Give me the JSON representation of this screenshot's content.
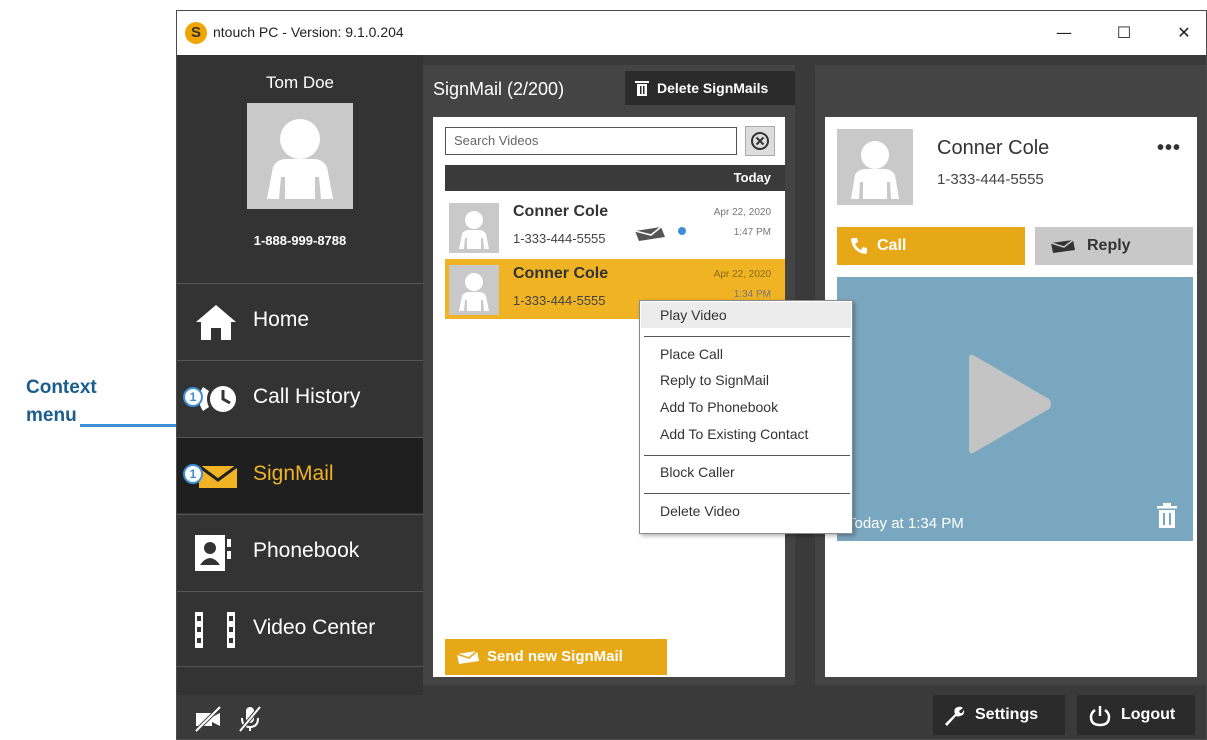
{
  "annotation": {
    "line1": "Context",
    "line2": "menu"
  },
  "window": {
    "title": "ntouch PC  -  Version: 9.1.0.204",
    "logo_letter": "S",
    "controls": [
      "—",
      "☐",
      "✕"
    ]
  },
  "user": {
    "name": "Tom Doe",
    "phone": "1-888-999-8788"
  },
  "nav": {
    "items": [
      {
        "label": "Home",
        "icon": "home-icon"
      },
      {
        "label": "Call History",
        "icon": "call-history-icon",
        "badge": "1"
      },
      {
        "label": "SignMail",
        "icon": "envelope-icon",
        "badge": "1",
        "active": true
      },
      {
        "label": "Phonebook",
        "icon": "phonebook-icon"
      },
      {
        "label": "Video Center",
        "icon": "film-icon"
      }
    ]
  },
  "signmail": {
    "title": "SignMail (2/200)",
    "delete_label": "Delete SignMails",
    "search_placeholder": "Search Videos",
    "date_group": "Today",
    "rows": [
      {
        "name": "Conner Cole",
        "phone": "1-333-444-5555",
        "date": "Apr 22, 2020",
        "time": "1:47 PM",
        "unread": true
      },
      {
        "name": "Conner Cole",
        "phone": "1-333-444-5555",
        "date": "Apr 22, 2020",
        "time": "1:34 PM",
        "selected": true
      }
    ],
    "send_label": "Send new SignMail"
  },
  "detail": {
    "name": "Conner Cole",
    "phone": "1-333-444-5555",
    "more": "•••",
    "call_label": "Call",
    "reply_label": "Reply",
    "video_caption": "Today at 1:34 PM"
  },
  "context_menu": {
    "items": [
      "Play Video",
      "Place Call",
      "Reply to SignMail",
      "Add To Phonebook",
      "Add To Existing Contact",
      "Block Caller",
      "Delete Video"
    ]
  },
  "bottom": {
    "settings_label": "Settings",
    "logout_label": "Logout"
  },
  "colors": {
    "accent": "#f0b323",
    "dark": "#333333",
    "annotation": "#3b8fd6"
  }
}
